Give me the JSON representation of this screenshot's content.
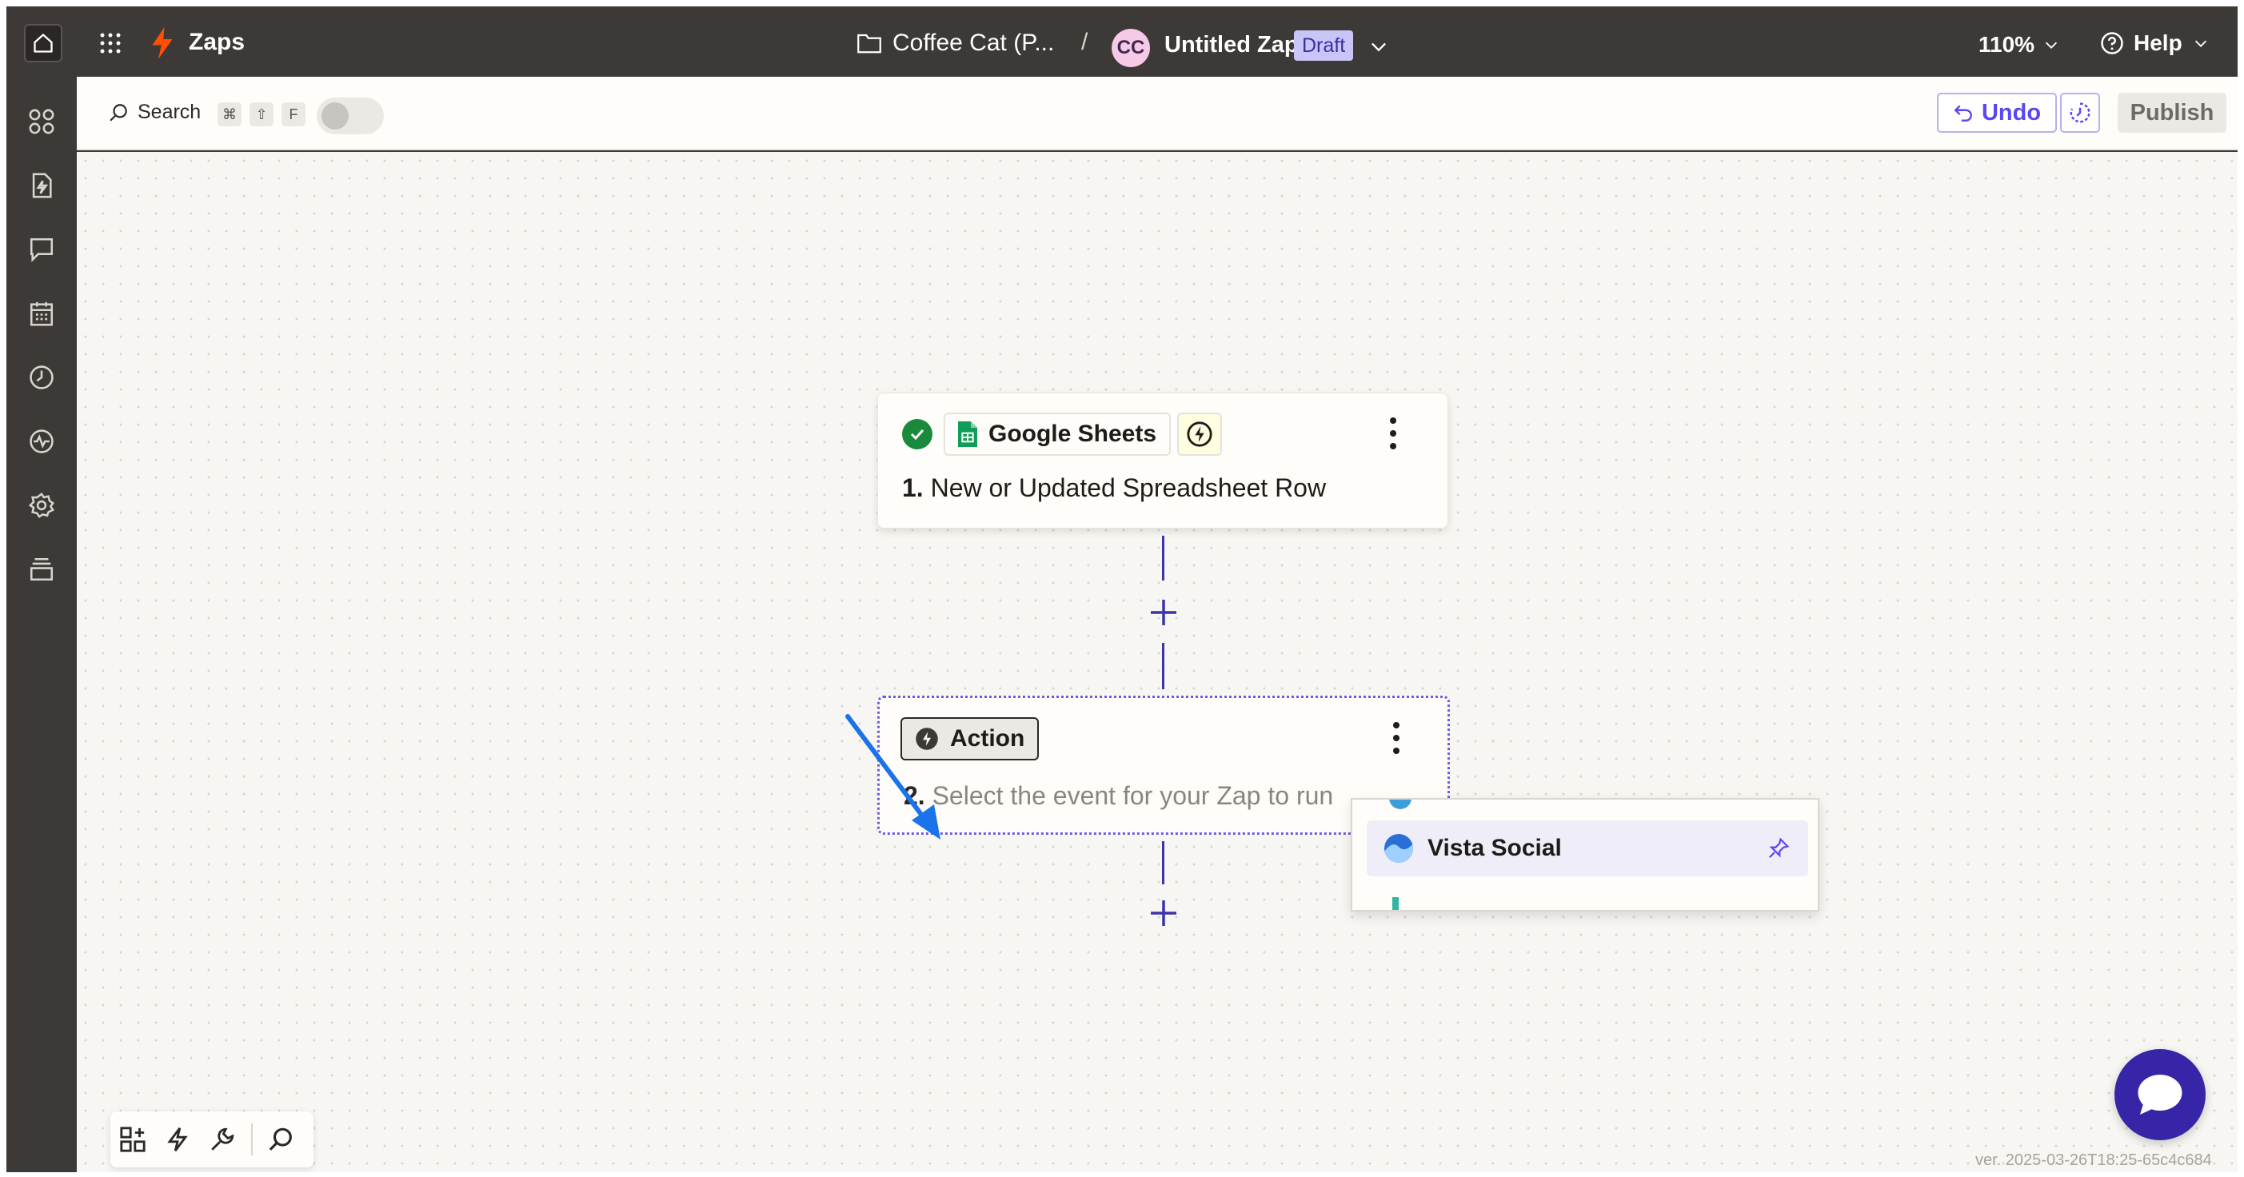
{
  "topbar": {
    "brand": "Zaps",
    "folder": "Coffee Cat (P...",
    "separator": "/",
    "avatar_initials": "CC",
    "zap_name": "Untitled Zap",
    "status_badge": "Draft",
    "zoom": "110%",
    "help": "Help"
  },
  "toolbar": {
    "search_label": "Search",
    "shortcut_keys": [
      "⌘",
      "⇧",
      "F"
    ],
    "undo_label": "Undo",
    "publish_label": "Publish"
  },
  "steps": [
    {
      "number": "1.",
      "app": "Google Sheets",
      "title": "New or Updated Spreadsheet Row",
      "status": "complete"
    },
    {
      "number": "2.",
      "app": "Action",
      "title": "Select the event for your Zap to run"
    }
  ],
  "dropdown": {
    "highlighted_item": "Vista Social"
  },
  "sidebar": {
    "items": [
      "apps-icon",
      "zap-file-icon",
      "chat-icon",
      "calendar-icon",
      "history-icon",
      "activity-icon",
      "settings-icon",
      "layers-icon"
    ]
  },
  "footer": {
    "version": "ver. 2025-03-26T18:25-65c4c684"
  },
  "colors": {
    "accent": "#5b47f0",
    "topbar_bg": "#3d3936",
    "brand_orange": "#ff4f00",
    "success": "#198a3b",
    "connector": "#3d34a8",
    "chat_button": "#3626a7",
    "annotation_arrow": "#1a73e8"
  }
}
